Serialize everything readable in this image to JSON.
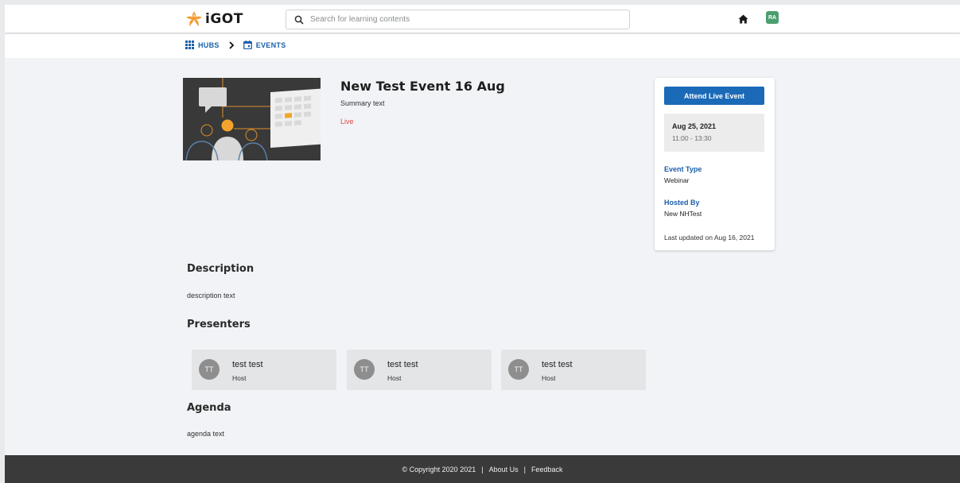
{
  "header": {
    "logo_text": "iGOT",
    "search_placeholder": "Search for learning contents",
    "avatar_initials": "RA",
    "avatar_color": "#4c9e6e"
  },
  "breadcrumb": {
    "items": [
      {
        "label": "HUBS",
        "icon": "grid-icon"
      },
      {
        "label": "EVENTS",
        "icon": "calendar-icon"
      }
    ]
  },
  "event": {
    "title": "New Test Event 16 Aug",
    "summary": "Summary text",
    "status": "Live",
    "status_color": "#e04a4a"
  },
  "sidebar_card": {
    "attend_label": "Attend Live Event",
    "date": "Aug 25, 2021",
    "time": "11:00 - 13:30",
    "event_type_label": "Event Type",
    "event_type_value": "Webinar",
    "hosted_by_label": "Hosted By",
    "hosted_by_value": "New NHTest",
    "last_updated": "Last updated on Aug 16, 2021",
    "accent_color": "#1b6ab8"
  },
  "description": {
    "title": "Description",
    "text": "description text"
  },
  "presenters": {
    "title": "Presenters",
    "items": [
      {
        "initials": "TT",
        "name": "test test",
        "role": "Host"
      },
      {
        "initials": "TT",
        "name": "test test",
        "role": "Host"
      },
      {
        "initials": "TT",
        "name": "test test",
        "role": "Host"
      }
    ]
  },
  "agenda": {
    "title": "Agenda",
    "text": "agenda text"
  },
  "footer": {
    "copyright": "© Copyright 2020 2021",
    "sep": "|",
    "about": "About Us",
    "feedback": "Feedback"
  }
}
